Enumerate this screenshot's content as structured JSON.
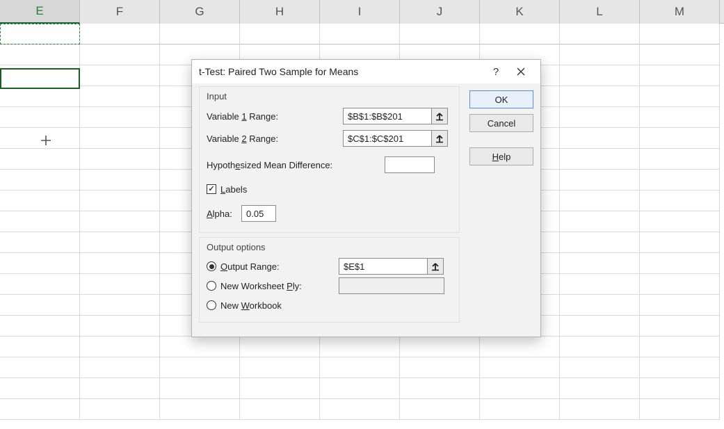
{
  "columns": [
    "E",
    "F",
    "G",
    "H",
    "I",
    "J",
    "K",
    "L",
    "M"
  ],
  "selected_column_index": 0,
  "dialog": {
    "title": "t-Test: Paired Two Sample for Means",
    "help_icon_tip": "?",
    "close_icon_tip": "×",
    "buttons": {
      "ok": "OK",
      "cancel": "Cancel",
      "help": "Help"
    },
    "input_group": {
      "title": "Input",
      "var1_label_pre": "Variable ",
      "var1_label_u": "1",
      "var1_label_post": " Range:",
      "var2_label_pre": "Variable ",
      "var2_label_u": "2",
      "var2_label_post": " Range:",
      "var1_value": "$B$1:$B$201",
      "var2_value": "$C$1:$C$201",
      "hypo_label_pre": "Hypoth",
      "hypo_label_u": "e",
      "hypo_label_post": "sized Mean Difference:",
      "hypo_value": "",
      "labels_check_u": "L",
      "labels_check_post": "abels",
      "labels_checked": true,
      "alpha_label_u": "A",
      "alpha_label_post": "lpha:",
      "alpha_value": "0.05"
    },
    "output_group": {
      "title": "Output options",
      "output_range_u": "O",
      "output_range_post": "utput Range:",
      "output_range_value": "$E$1",
      "output_option": "range",
      "ply_pre": "New Worksheet ",
      "ply_u": "P",
      "ply_post": "ly:",
      "ply_value": "",
      "wb_pre": "New ",
      "wb_u": "W",
      "wb_post": "orkbook"
    }
  }
}
